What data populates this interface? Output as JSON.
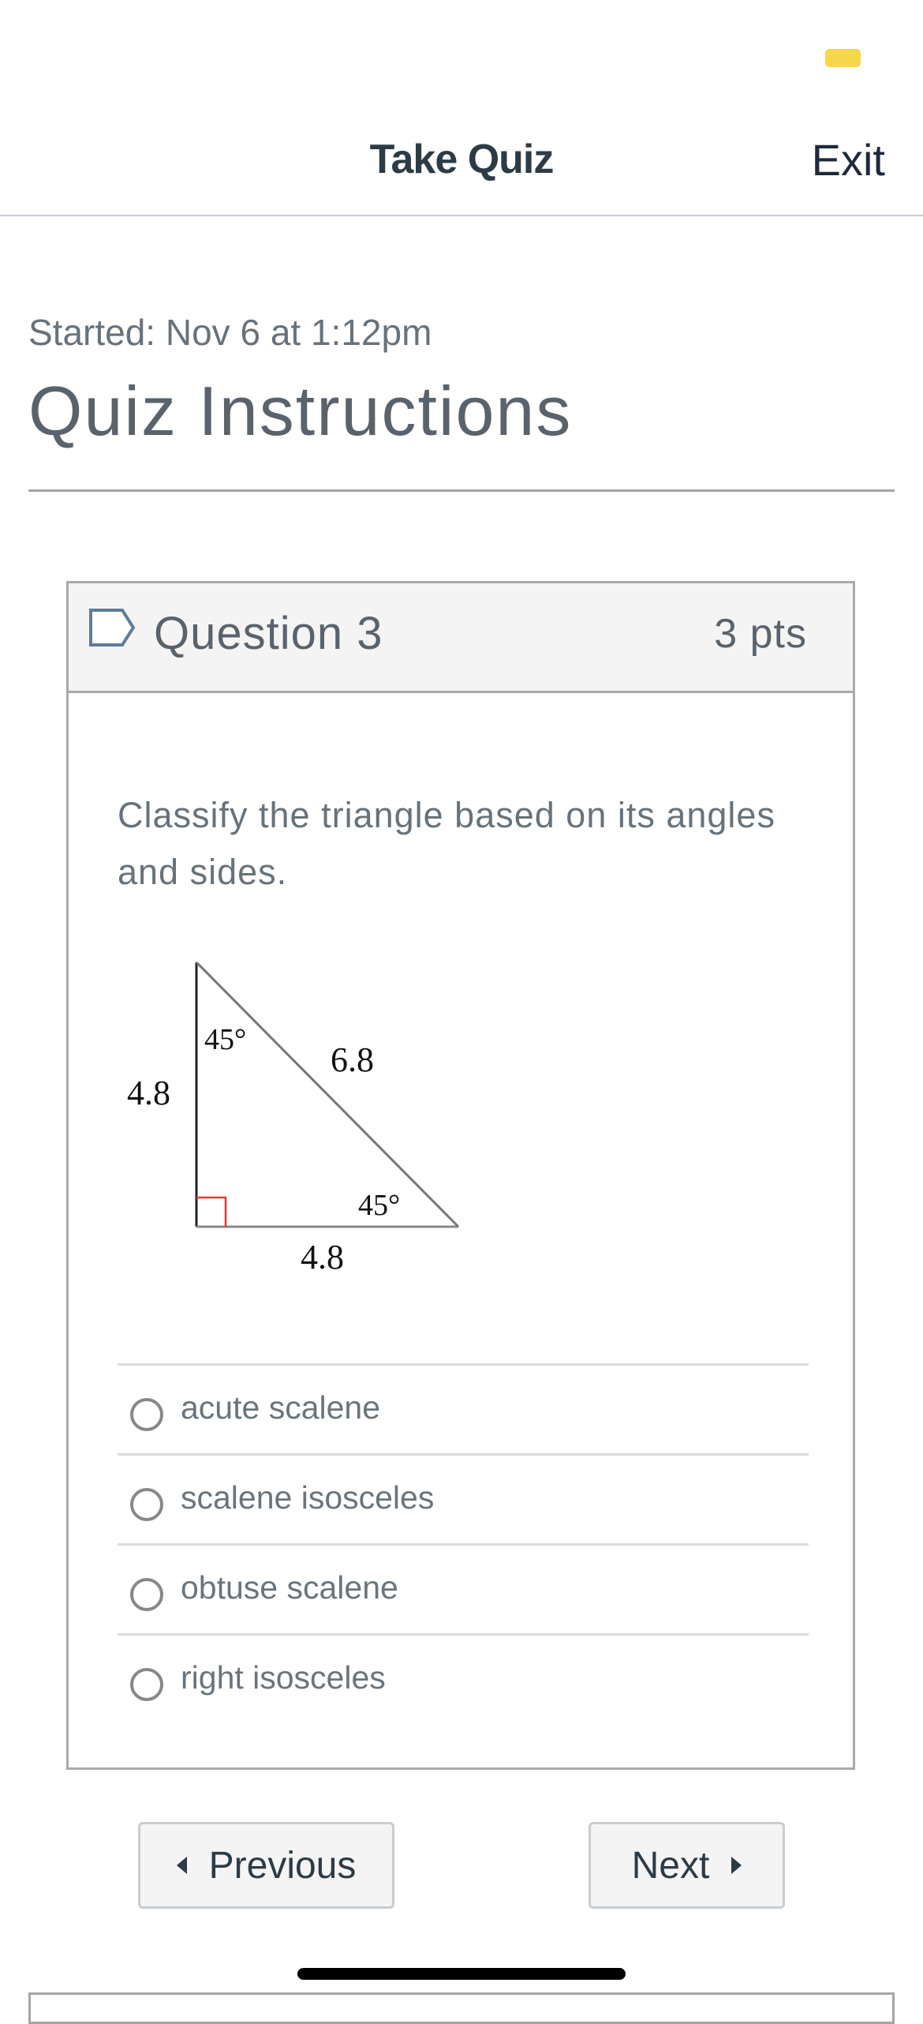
{
  "status_indicator": {
    "color": "#f7d74a"
  },
  "topbar": {
    "title": "Take Quiz",
    "exit_label": "Exit"
  },
  "quiz": {
    "started": "Started: Nov 6 at 1:12pm",
    "title": "Quiz Instructions"
  },
  "question": {
    "flag_icon": "flag-question-icon",
    "name": "Question 3",
    "points": "3 pts",
    "text": "Classify the triangle based on its angles and sides.",
    "figure": {
      "description": "Right triangle with a right-angle marker",
      "left_side": "4.8",
      "bottom_side": "4.8",
      "hypotenuse": "6.8",
      "top_angle": "45°",
      "right_angle": "45°",
      "right_angle_marker_color": "#e53935"
    },
    "answers": [
      {
        "label": "acute scalene",
        "selected": false
      },
      {
        "label": "scalene isosceles",
        "selected": false
      },
      {
        "label": "obtuse scalene",
        "selected": false
      },
      {
        "label": "right isosceles",
        "selected": false
      }
    ]
  },
  "navigation": {
    "previous_label": "Previous",
    "next_label": "Next"
  }
}
